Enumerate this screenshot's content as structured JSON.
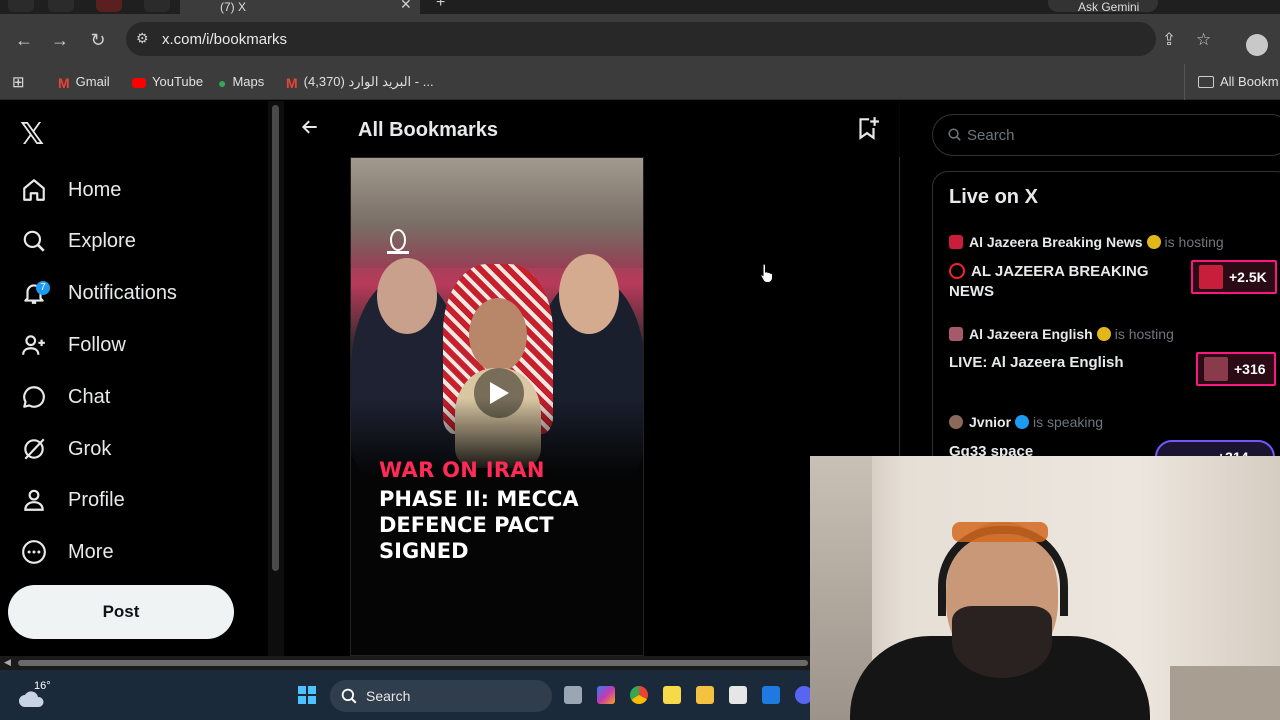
{
  "browser": {
    "active_tab_title": "(7) X",
    "tab_close": "✕",
    "new_tab": "+",
    "ask_gemini": "Ask Gemini",
    "url": "x.com/i/bookmarks"
  },
  "bookmarks_bar": [
    {
      "label": "Gmail",
      "color": "#ea4335"
    },
    {
      "label": "YouTube",
      "color": "#ff0000"
    },
    {
      "label": "Maps",
      "color": "#34a853"
    },
    {
      "label": "(4,370) البريد الوارد - ...",
      "color": "#ea4335"
    }
  ],
  "bookmarks_folder": "All Bookm",
  "x_logo": "𝕏",
  "nav": [
    {
      "label": "Home",
      "icon": "home-icon"
    },
    {
      "label": "Explore",
      "icon": "search-icon"
    },
    {
      "label": "Notifications",
      "icon": "bell-icon",
      "badge": "7"
    },
    {
      "label": "Follow",
      "icon": "add-person-icon"
    },
    {
      "label": "Chat",
      "icon": "chat-icon"
    },
    {
      "label": "Grok",
      "icon": "grok-icon"
    },
    {
      "label": "Profile",
      "icon": "person-icon"
    },
    {
      "label": "More",
      "icon": "more-icon"
    }
  ],
  "post_button": "Post",
  "main": {
    "title": "All Bookmarks",
    "media": {
      "source_logo": "ALJAZEERA",
      "headline_red": "WAR ON IRAN",
      "headline_white": "PHASE II: MECCA DEFENCE PACT SIGNED"
    }
  },
  "right": {
    "search_placeholder": "Search",
    "live_title": "Live on X",
    "items": [
      {
        "host": "Al Jazeera Breaking News",
        "verb": "is hosting",
        "title": "AL JAZEERA BREAKING NEWS",
        "live_dot": true,
        "listeners": "+2.5K",
        "verified_color": "#e2b719"
      },
      {
        "host": "Al Jazeera English",
        "verb": "is hosting",
        "title": "LIVE: Al Jazeera English",
        "live_dot": false,
        "listeners": "+316",
        "verified_color": "#e2b719"
      },
      {
        "host": "Jvnior",
        "verb": "is speaking",
        "title": "Gg33 space",
        "live_dot": false,
        "listeners": "+314",
        "verified_color": "#1d9bf0"
      }
    ]
  },
  "taskbar": {
    "temperature": "16°",
    "search_label": "Search"
  },
  "colors": {
    "accent": "#1d9bf0",
    "live_pink": "#f91880",
    "headline_red": "#ff2a55"
  }
}
